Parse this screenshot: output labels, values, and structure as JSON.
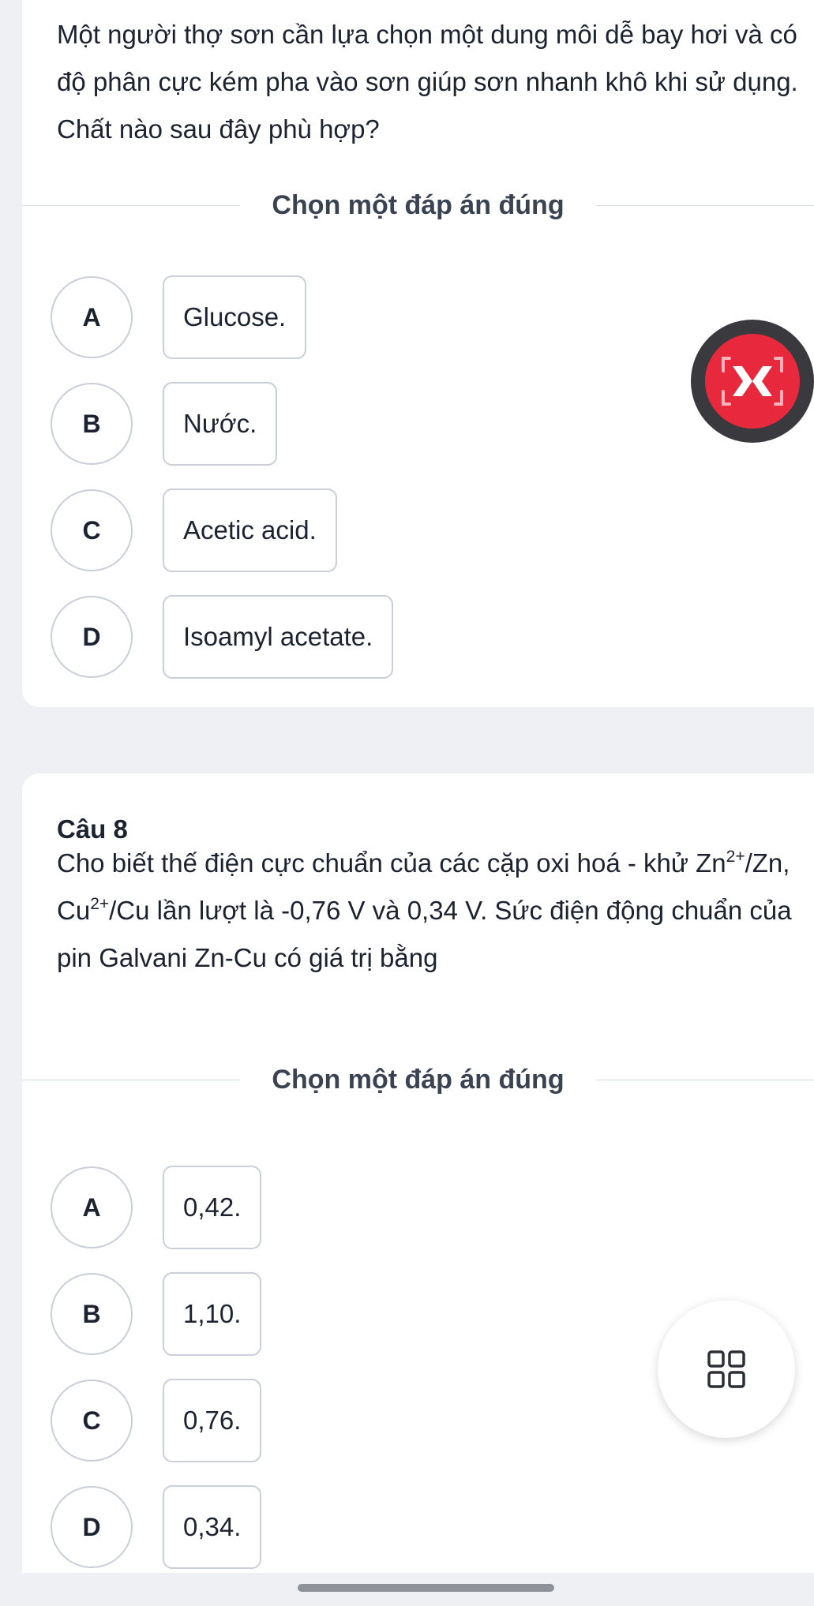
{
  "question7": {
    "text": "Một người thợ sơn cần lựa chọn một dung môi dễ bay hơi và có độ phân cực kém pha vào sơn giúp sơn nhanh khô khi sử dụng. Chất nào sau đây phù hợp?",
    "prompt": "Chọn một đáp án đúng",
    "options": [
      {
        "letter": "A",
        "text": "Glucose."
      },
      {
        "letter": "B",
        "text": "Nước."
      },
      {
        "letter": "C",
        "text": "Acetic acid."
      },
      {
        "letter": "D",
        "text": "Isoamyl acetate."
      }
    ]
  },
  "question8": {
    "title": "Câu 8",
    "text_part1": "Cho biết thế điện cực chuẩn của các cặp oxi hoá - khử Zn",
    "sup1": "2+",
    "text_part2": "/Zn, Cu",
    "sup2": "2+",
    "text_part3": "/Cu lần lượt là -0,76 V và 0,34 V. Sức điện động chuẩn của pin Galvani Zn-Cu có giá trị bằng",
    "prompt": "Chọn một đáp án đúng",
    "options": [
      {
        "letter": "A",
        "text": "0,42."
      },
      {
        "letter": "B",
        "text": "1,10."
      },
      {
        "letter": "C",
        "text": "0,76."
      },
      {
        "letter": "D",
        "text": "0,34."
      }
    ]
  },
  "floating": {
    "red_icon": "scan-bracket-icon",
    "white_icon": "grid-menu-icon",
    "red_color": "#e8283d"
  }
}
